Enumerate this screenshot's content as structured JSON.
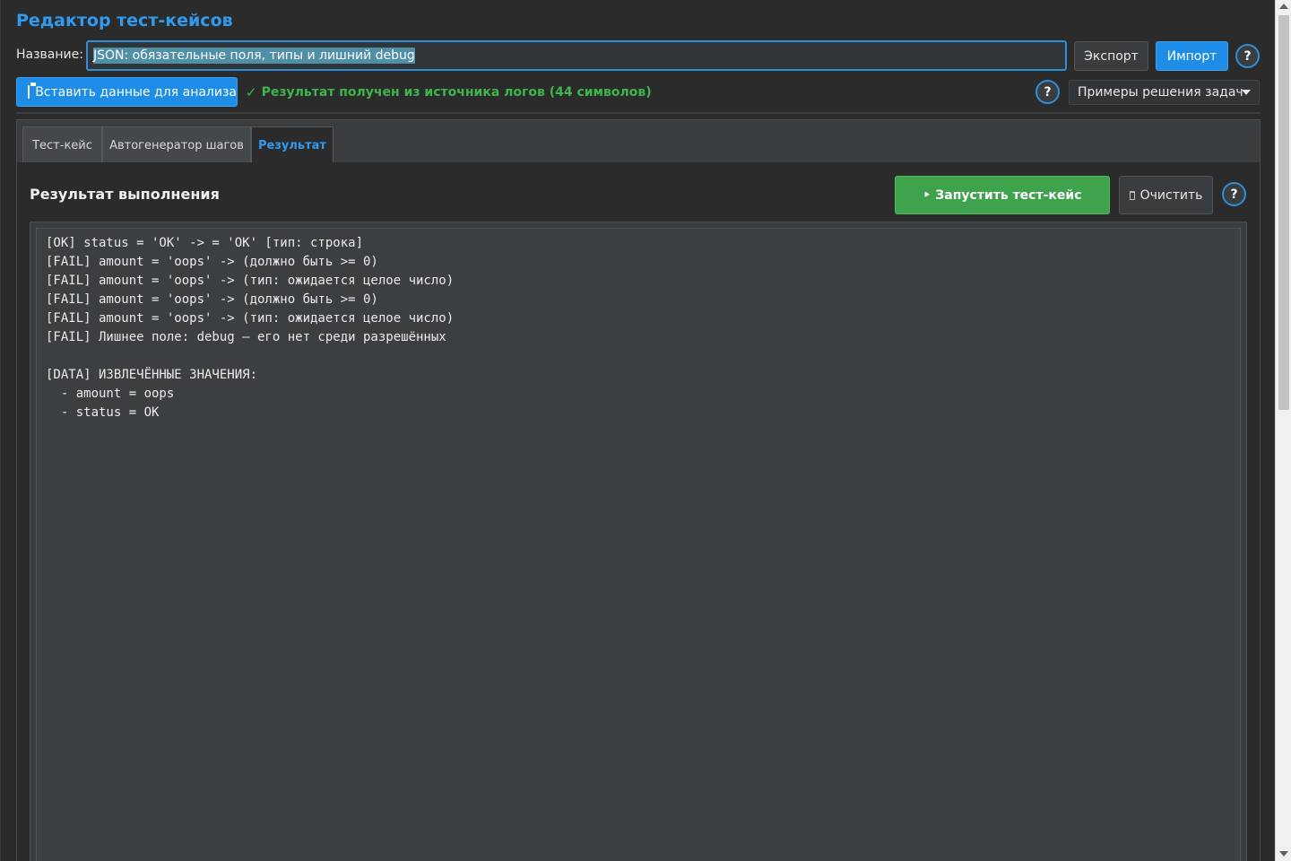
{
  "app": {
    "title": "Редактор тест-кейсов"
  },
  "header": {
    "name_label": "Название:",
    "name_value": "JSON: обязательные поля, типы и лишний debug",
    "export_label": "Экспорт",
    "import_label": "Импорт",
    "help_label": "?"
  },
  "toolbar": {
    "paste_label": "Вставить данные для анализа",
    "status_text": "Результат получен из источника логов (44 символов)",
    "status_icon": "check-icon",
    "examples_selected": "Примеры решения задач"
  },
  "tabs": [
    {
      "label": "Тест-кейс",
      "active": false
    },
    {
      "label": "Автогенератор шагов",
      "active": false
    },
    {
      "label": "Результат",
      "active": true
    }
  ],
  "result": {
    "title": "Результат выполнения",
    "run_label": "‣ Запустить тест-кейс",
    "clear_label": "Очистить",
    "output_lines": [
      "[OK] status = 'OK' -> = 'OK' [тип: строка]",
      "[FAIL] amount = 'oops' -> (должно быть >= 0)",
      "[FAIL] amount = 'oops' -> (тип: ожидается целое число)",
      "[FAIL] amount = 'oops' -> (должно быть >= 0)",
      "[FAIL] amount = 'oops' -> (тип: ожидается целое число)",
      "[FAIL] Лишнее поле: debug — его нет среди разрешённых",
      "",
      "[DATA] ИЗВЛЕЧЁННЫЕ ЗНАЧЕНИЯ:",
      "  - amount = oops",
      "  - status = OK"
    ]
  },
  "colors": {
    "accent": "#1e8de8",
    "title_blue": "#2f9bf0",
    "success": "#3db64a",
    "run_button": "#3fa34d",
    "background": "#2b2b2b"
  }
}
